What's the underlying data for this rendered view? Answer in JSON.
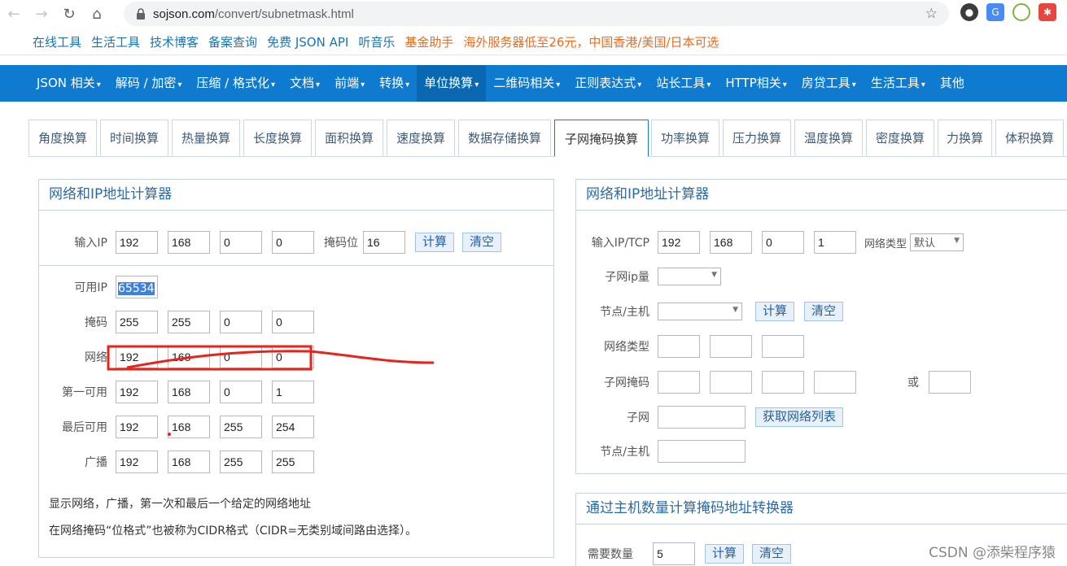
{
  "browser": {
    "url_host": "sojson.com",
    "url_path": "/convert/subnetmask.html"
  },
  "topbar": {
    "links": [
      "在线工具",
      "生活工具",
      "技术博客",
      "备案查询",
      "免费 JSON API",
      "听音乐",
      "基金助手",
      "海外服务器低至26元，中国香港/美国/日本可选"
    ]
  },
  "nav": {
    "items": [
      "JSON 相关",
      "解码 / 加密",
      "压缩 / 格式化",
      "文档",
      "前端",
      "转换",
      "单位换算",
      "二维码相关",
      "正则表达式",
      "站长工具",
      "HTTP相关",
      "房贷工具",
      "生活工具",
      "其他"
    ],
    "active_index": 6
  },
  "tabs": {
    "items": [
      "角度换算",
      "时间换算",
      "热量换算",
      "长度换算",
      "面积换算",
      "速度换算",
      "数据存储换算",
      "子网掩码换算",
      "功率换算",
      "压力换算",
      "温度换算",
      "密度换算",
      "力换算",
      "体积换算"
    ],
    "active_index": 7
  },
  "left": {
    "title": "网络和IP地址计算器",
    "input_ip_label": "输入IP",
    "ip": [
      "192",
      "168",
      "0",
      "0"
    ],
    "mask_bits_label": "掩码位",
    "mask_bits": "16",
    "calc_label": "计算",
    "clear_label": "清空",
    "usable_label": "可用IP",
    "usable_value": "65534",
    "mask_label": "掩码",
    "mask": [
      "255",
      "255",
      "0",
      "0"
    ],
    "network_label": "网络",
    "network": [
      "192",
      "168",
      "0",
      "0"
    ],
    "first_label": "第一可用",
    "first": [
      "192",
      "168",
      "0",
      "1"
    ],
    "last_label": "最后可用",
    "last": [
      "192",
      "168",
      "255",
      "254"
    ],
    "broadcast_label": "广播",
    "broadcast": [
      "192",
      "168",
      "255",
      "255"
    ],
    "note1": "显示网络，广播，第一次和最后一个给定的网络地址",
    "note2": "在网络掩码“位格式”也被称为CIDR格式（CIDR=无类别域间路由选择）。"
  },
  "right": {
    "title": "网络和IP地址计算器",
    "input_label": "输入IP/TCP",
    "ip": [
      "192",
      "168",
      "0",
      "1"
    ],
    "net_type_label": "网络类型",
    "net_type_value": "默认",
    "subnet_count_label": "子网ip量",
    "node_host_label": "节点/主机",
    "calc_label": "计算",
    "clear_label": "清空",
    "net_type2_label": "网络类型",
    "subnet_mask_label": "子网掩码",
    "or_label": "或",
    "subnet_label": "子网",
    "get_list_label": "获取网络列表",
    "node_host2_label": "节点/主机"
  },
  "right2": {
    "title": "通过主机数量计算掩码地址转换器",
    "need_label": "需要数量",
    "need_value": "5",
    "calc_label": "计算",
    "clear_label": "清空"
  },
  "watermark": "CSDN @添柴程序猿",
  "colors": {
    "nav": "#0e7ad0",
    "annotation": "#e8231b"
  }
}
